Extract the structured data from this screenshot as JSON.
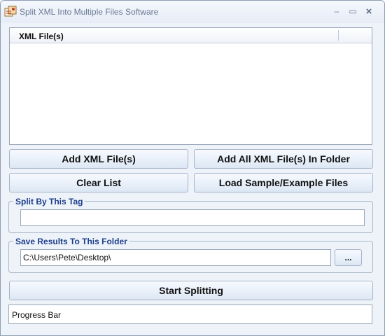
{
  "window": {
    "title": "Split XML Into Multiple Files Software",
    "minimize_glyph": "–",
    "maximize_glyph": "▭",
    "close_glyph": "×"
  },
  "file_list": {
    "column_header": "XML File(s)",
    "items": []
  },
  "buttons": {
    "add_files": "Add XML File(s)",
    "add_folder": "Add All XML File(s) In Folder",
    "clear_list": "Clear List",
    "load_samples": "Load Sample/Example Files",
    "browse": "...",
    "start": "Start Splitting"
  },
  "split_tag": {
    "label": "Split By This Tag",
    "value": ""
  },
  "save_folder": {
    "label": "Save Results To This Folder",
    "value": "C:\\Users\\Pete\\Desktop\\"
  },
  "progress": {
    "label": "Progress Bar"
  }
}
